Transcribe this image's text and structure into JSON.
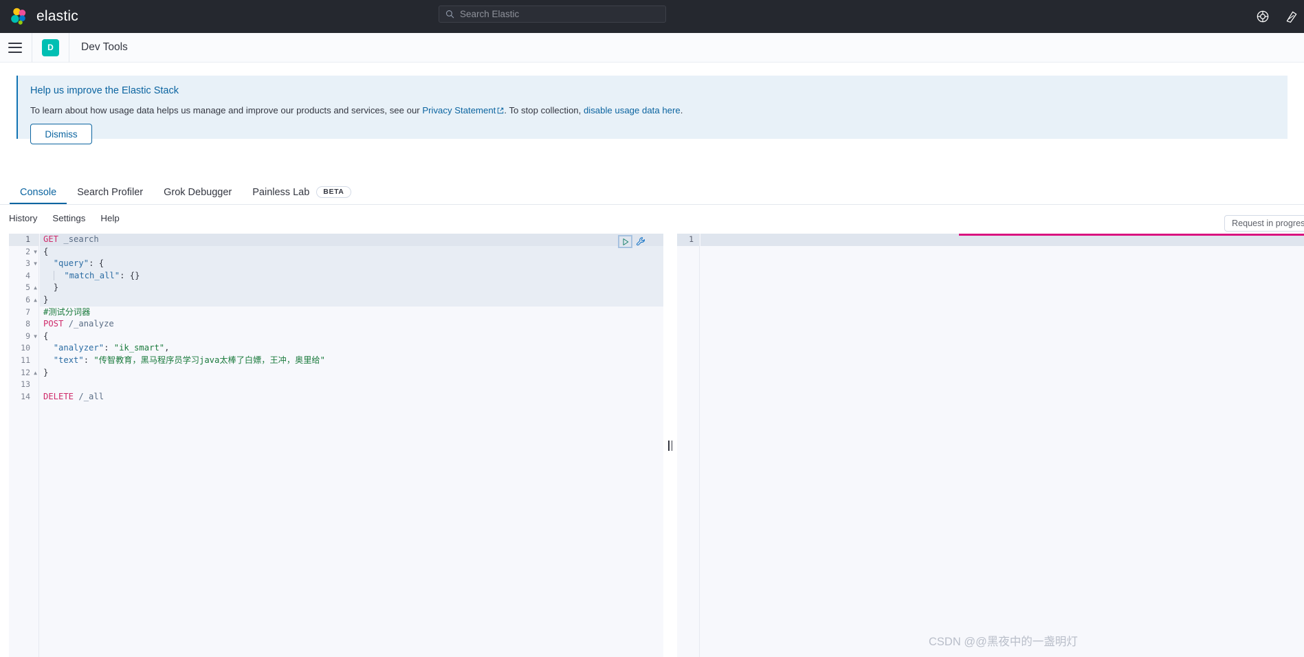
{
  "header": {
    "brand_name": "elastic",
    "logo_icon": "elastic-logo-icon",
    "search": {
      "icon": "search-icon",
      "placeholder": "Search Elastic",
      "value": ""
    },
    "icons": [
      {
        "name": "help-icon",
        "label": "Help"
      },
      {
        "name": "news-feed-icon",
        "label": "News"
      }
    ]
  },
  "chrome": {
    "menu_icon": "hamburger-menu-icon",
    "app_badge": "D",
    "page_title": "Dev Tools"
  },
  "callout": {
    "title": "Help us improve the Elastic Stack",
    "body_prefix": "To learn about how usage data helps us manage and improve our products and services, see our ",
    "link_privacy": "Privacy Statement",
    "external_icon": "external-link-icon",
    "body_middle": ". To stop collection, ",
    "link_disable": "disable usage data here",
    "body_suffix": ".",
    "dismiss_label": "Dismiss"
  },
  "tabs": [
    {
      "label": "Console",
      "active": true,
      "badge": ""
    },
    {
      "label": "Search Profiler",
      "active": false,
      "badge": ""
    },
    {
      "label": "Grok Debugger",
      "active": false,
      "badge": ""
    },
    {
      "label": "Painless Lab",
      "active": false,
      "badge": "BETA"
    }
  ],
  "console_menu": [
    {
      "label": "History"
    },
    {
      "label": "Settings"
    },
    {
      "label": "Help"
    }
  ],
  "status": {
    "request_badge": "Request in progress…",
    "progress_color": "#d9127f"
  },
  "editor": {
    "send_request_icon": "play-icon",
    "wrench_icon": "wrench-icon",
    "lines": [
      {
        "n": "1",
        "fold": "",
        "active": true,
        "highlight": true,
        "tokens": [
          {
            "t": "method",
            "v": "GET"
          },
          {
            "t": "plain",
            "v": " "
          },
          {
            "t": "url",
            "v": "_search"
          }
        ]
      },
      {
        "n": "2",
        "fold": "down",
        "highlight": true,
        "tokens": [
          {
            "t": "punct",
            "v": "{"
          }
        ]
      },
      {
        "n": "3",
        "fold": "down",
        "highlight": true,
        "tokens": [
          {
            "t": "plain",
            "v": "  "
          },
          {
            "t": "key",
            "v": "\"query\""
          },
          {
            "t": "punct",
            "v": ": {"
          }
        ]
      },
      {
        "n": "4",
        "fold": "",
        "highlight": true,
        "guide": true,
        "tokens": [
          {
            "t": "plain",
            "v": "    "
          },
          {
            "t": "key",
            "v": "\"match_all\""
          },
          {
            "t": "punct",
            "v": ": {}"
          }
        ]
      },
      {
        "n": "5",
        "fold": "up",
        "highlight": true,
        "tokens": [
          {
            "t": "plain",
            "v": "  "
          },
          {
            "t": "punct",
            "v": "}"
          }
        ]
      },
      {
        "n": "6",
        "fold": "up",
        "highlight": true,
        "tokens": [
          {
            "t": "punct",
            "v": "}"
          }
        ]
      },
      {
        "n": "7",
        "fold": "",
        "highlight": false,
        "tokens": [
          {
            "t": "comment",
            "v": "#测试分词器"
          }
        ]
      },
      {
        "n": "8",
        "fold": "",
        "highlight": false,
        "tokens": [
          {
            "t": "method",
            "v": "POST"
          },
          {
            "t": "plain",
            "v": " "
          },
          {
            "t": "url",
            "v": "/_analyze"
          }
        ]
      },
      {
        "n": "9",
        "fold": "down",
        "highlight": false,
        "tokens": [
          {
            "t": "punct",
            "v": "{"
          }
        ]
      },
      {
        "n": "10",
        "fold": "",
        "highlight": false,
        "tokens": [
          {
            "t": "plain",
            "v": "  "
          },
          {
            "t": "key",
            "v": "\"analyzer\""
          },
          {
            "t": "punct",
            "v": ": "
          },
          {
            "t": "string",
            "v": "\"ik_smart\""
          },
          {
            "t": "punct",
            "v": ","
          }
        ]
      },
      {
        "n": "11",
        "fold": "",
        "highlight": false,
        "tokens": [
          {
            "t": "plain",
            "v": "  "
          },
          {
            "t": "key",
            "v": "\"text\""
          },
          {
            "t": "punct",
            "v": ": "
          },
          {
            "t": "string",
            "v": "\"传智教育，黑马程序员学习java太棒了白嫖，王冲，奥里给\""
          }
        ]
      },
      {
        "n": "12",
        "fold": "up",
        "highlight": false,
        "tokens": [
          {
            "t": "punct",
            "v": "}"
          }
        ]
      },
      {
        "n": "13",
        "fold": "",
        "highlight": false,
        "tokens": [
          {
            "t": "plain",
            "v": ""
          }
        ]
      },
      {
        "n": "14",
        "fold": "",
        "highlight": false,
        "tokens": [
          {
            "t": "method",
            "v": "DELETE"
          },
          {
            "t": "plain",
            "v": " "
          },
          {
            "t": "url",
            "v": "/_all"
          }
        ]
      }
    ]
  },
  "response": {
    "lines": [
      {
        "n": "1",
        "text": ""
      }
    ]
  },
  "watermark": "CSDN @@黑夜中的一盏明灯"
}
